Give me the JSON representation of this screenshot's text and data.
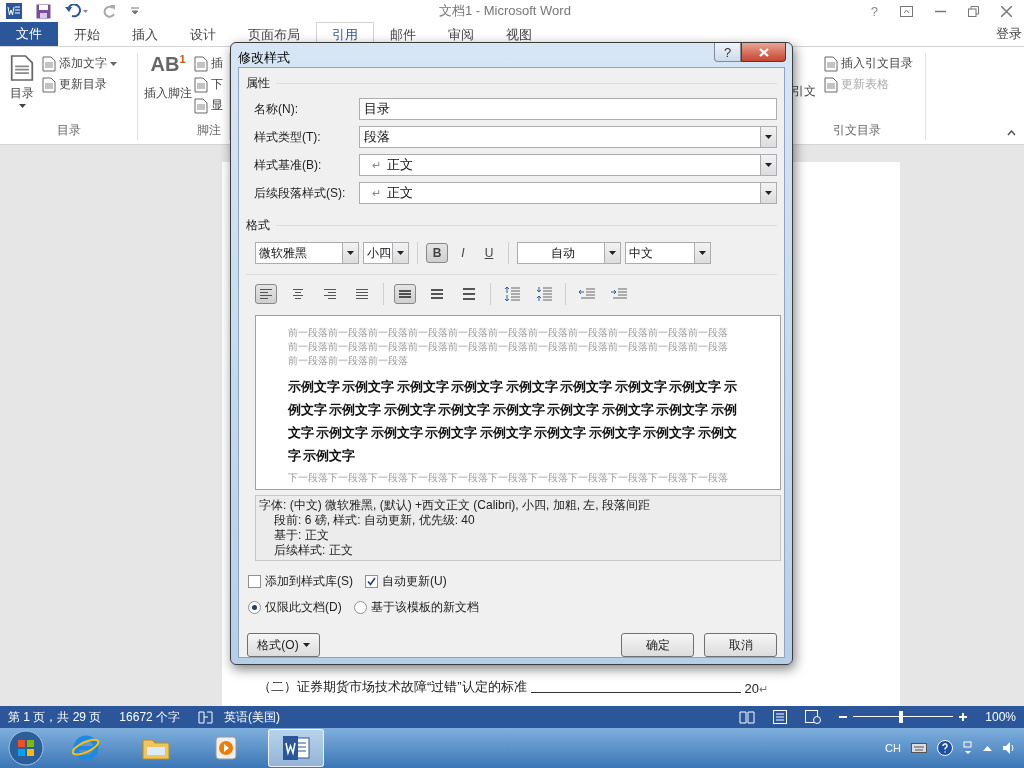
{
  "title_bar": {
    "title": "文档1 - Microsoft Word",
    "help": "?"
  },
  "ribbon_tabs": [
    {
      "label": "文件",
      "kind": "file",
      "selected": false
    },
    {
      "label": "开始",
      "kind": "tab",
      "selected": false
    },
    {
      "label": "插入",
      "kind": "tab",
      "selected": false
    },
    {
      "label": "设计",
      "kind": "tab",
      "selected": false
    },
    {
      "label": "页面布局",
      "kind": "tab",
      "selected": false
    },
    {
      "label": "引用",
      "kind": "tab",
      "selected": true
    },
    {
      "label": "邮件",
      "kind": "tab",
      "selected": false
    },
    {
      "label": "审阅",
      "kind": "tab",
      "selected": false
    },
    {
      "label": "视图",
      "kind": "tab",
      "selected": false
    }
  ],
  "account": "登录",
  "ribbon": {
    "toc": {
      "button": "目录",
      "items": [
        {
          "label": "添加文字",
          "kind": "dropdown"
        },
        {
          "label": "更新目录",
          "kind": "plain"
        }
      ],
      "label": "目录"
    },
    "footnote": {
      "badge": "AB$^{1}$",
      "button": "插入脚注",
      "items": [
        "插",
        "下",
        "显"
      ],
      "label": "脚注"
    },
    "citation": {
      "button": "引文",
      "items": [
        {
          "label": "插入引文目录",
          "disabled": false
        },
        {
          "label": "更新表格",
          "disabled": true
        }
      ],
      "label": "引文目录"
    }
  },
  "document": {
    "lines": [
      {
        "text": "（二）证券期货市场技术故障“过错”认定的标准",
        "page": "20",
        "mark": "↵"
      }
    ]
  },
  "dialog": {
    "title": "修改样式",
    "help": "?",
    "properties_header": "属性",
    "properties": [
      {
        "label": "名称(N):",
        "value": "目录",
        "kind": "text"
      },
      {
        "label": "样式类型(T):",
        "value": "段落",
        "kind": "select"
      },
      {
        "label": "样式基准(B):",
        "mark": "↵",
        "value": "正文",
        "kind": "select"
      },
      {
        "label": "后续段落样式(S):",
        "mark": "↵",
        "value": "正文",
        "kind": "select"
      }
    ],
    "format_header": "格式",
    "format": {
      "font": "微软雅黑",
      "size": "小四",
      "styles": [
        {
          "label": "B",
          "kind": "bold",
          "selected": true
        },
        {
          "label": "I",
          "kind": "italic",
          "selected": false
        },
        {
          "label": "U",
          "kind": "underline",
          "selected": false
        }
      ],
      "swatch_label": "自动",
      "language": "中文"
    },
    "paragraph_tools": [
      [
        {
          "kind": "left",
          "selected": true
        },
        {
          "kind": "center",
          "selected": false
        },
        {
          "kind": "right",
          "selected": false
        },
        {
          "kind": "justify",
          "selected": false
        }
      ],
      [
        {
          "kind": "single",
          "selected": true
        },
        {
          "kind": "onehalf",
          "selected": false
        },
        {
          "kind": "double",
          "selected": false
        }
      ],
      [
        {
          "kind": "increase",
          "selected": false
        },
        {
          "kind": "decrease",
          "selected": false
        }
      ],
      [
        {
          "kind": "outdent",
          "selected": false
        },
        {
          "kind": "indent",
          "selected": false
        }
      ]
    ],
    "preview": {
      "previous": "前一段落前一段落前一段落前一段落前一段落前一段落前一段落前一段落前一段落前一段落前一段落前一段落前一段落前一段落前一段落前一段落前一段落前一段落前一段落前一段落前一段落前一段落前一段落前一段落前一段落",
      "sample": "示例文字 示例文字 示例文字 示例文字 示例文字 示例文字 示例文字 示例文字 示例文字 示例文字 示例文字 示例文字 示例文字 示例文字 示例文字 示例文字 示例文字 示例文字 示例文字 示例文字 示例文字 示例文字 示例文字 示例文字 示例文字 示例文字",
      "next": "下一段落下一段落下一段落下一段落下一段落下一段落下一段落下一段落下一段落下一段落下一段落"
    },
    "description": [
      "字体: (中文) 微软雅黑, (默认) +西文正文 (Calibri), 小四, 加粗, 左, 段落间距",
      "段前: 6 磅, 样式: 自动更新, 优先级: 40",
      "基于: 正文",
      "后续样式: 正文"
    ],
    "options": [
      {
        "label": "添加到样式库(S)",
        "checked": false
      },
      {
        "label": "自动更新(U)",
        "checked": true
      }
    ],
    "scope": [
      {
        "label": "仅限此文档(D)",
        "selected": true
      },
      {
        "label": "基于该模板的新文档",
        "selected": false
      }
    ],
    "format_button": "格式(O)",
    "ok": "确定",
    "cancel": "取消"
  },
  "status_bar": {
    "page": "第 1 页，共 29 页",
    "words": "16672 个字",
    "language": "英语(美国)",
    "zoom": {
      "level": 0.48,
      "reading": "100%"
    }
  },
  "taskbar": {
    "apps": [
      {
        "kind": "ie",
        "selected": false
      },
      {
        "kind": "explorer",
        "selected": false
      },
      {
        "kind": "media",
        "selected": false
      },
      {
        "kind": "word",
        "selected": true
      }
    ],
    "ime": "CH"
  }
}
